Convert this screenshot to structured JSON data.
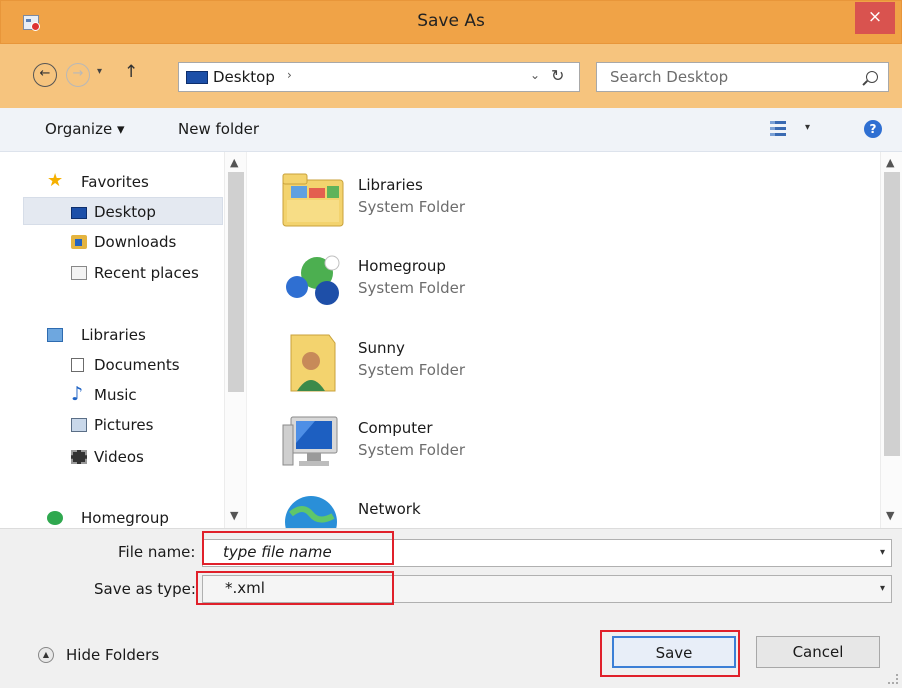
{
  "window": {
    "title": "Save As",
    "close_glyph": "×"
  },
  "nav": {
    "back_glyph": "←",
    "forward_glyph": "→",
    "recent_glyph": "▾",
    "up_glyph": "↑"
  },
  "address": {
    "location": "Desktop",
    "separator_glyph": "›",
    "dropdown_glyph": "⌄",
    "refresh_glyph": "↻"
  },
  "search": {
    "placeholder": "Search Desktop"
  },
  "toolbar": {
    "organize_label": "Organize ▾",
    "new_folder_label": "New folder",
    "view_dropdown_glyph": "▾",
    "help_glyph": "?"
  },
  "sidebar": {
    "favorites_label": "Favorites",
    "favorites": [
      {
        "label": "Desktop",
        "icon": "desktop-icon",
        "selected": true
      },
      {
        "label": "Downloads",
        "icon": "downloads-icon"
      },
      {
        "label": "Recent places",
        "icon": "recent-places-icon"
      }
    ],
    "libraries_label": "Libraries",
    "libraries": [
      {
        "label": "Documents",
        "icon": "documents-icon"
      },
      {
        "label": "Music",
        "icon": "music-icon"
      },
      {
        "label": "Pictures",
        "icon": "pictures-icon"
      },
      {
        "label": "Videos",
        "icon": "videos-icon"
      }
    ],
    "homegroup_label": "Homegroup",
    "scroll_up_glyph": "▲",
    "scroll_down_glyph": "▼"
  },
  "items": [
    {
      "name": "Libraries",
      "type": "System Folder",
      "icon": "libraries-folder-icon"
    },
    {
      "name": "Homegroup",
      "type": "System Folder",
      "icon": "homegroup-icon"
    },
    {
      "name": "Sunny",
      "type": "System Folder",
      "icon": "user-folder-icon"
    },
    {
      "name": "Computer",
      "type": "System Folder",
      "icon": "computer-icon"
    },
    {
      "name": "Network",
      "type": "",
      "icon": "network-icon"
    }
  ],
  "form": {
    "file_name_label": "File name:",
    "file_name_value": "type file name",
    "save_type_label": "Save as type:",
    "save_type_value": "*.xml",
    "dropdown_glyph": "▾"
  },
  "footer": {
    "hide_folders_label": "Hide Folders",
    "hide_glyph": "▲",
    "save_label": "Save",
    "cancel_label": "Cancel"
  },
  "colors": {
    "titlebar": "#f0a347",
    "address_bar_bg": "#f6c47e",
    "close_button": "#d9534f",
    "highlight_box": "#e0202a",
    "selected_item": "#e4e9f1"
  }
}
